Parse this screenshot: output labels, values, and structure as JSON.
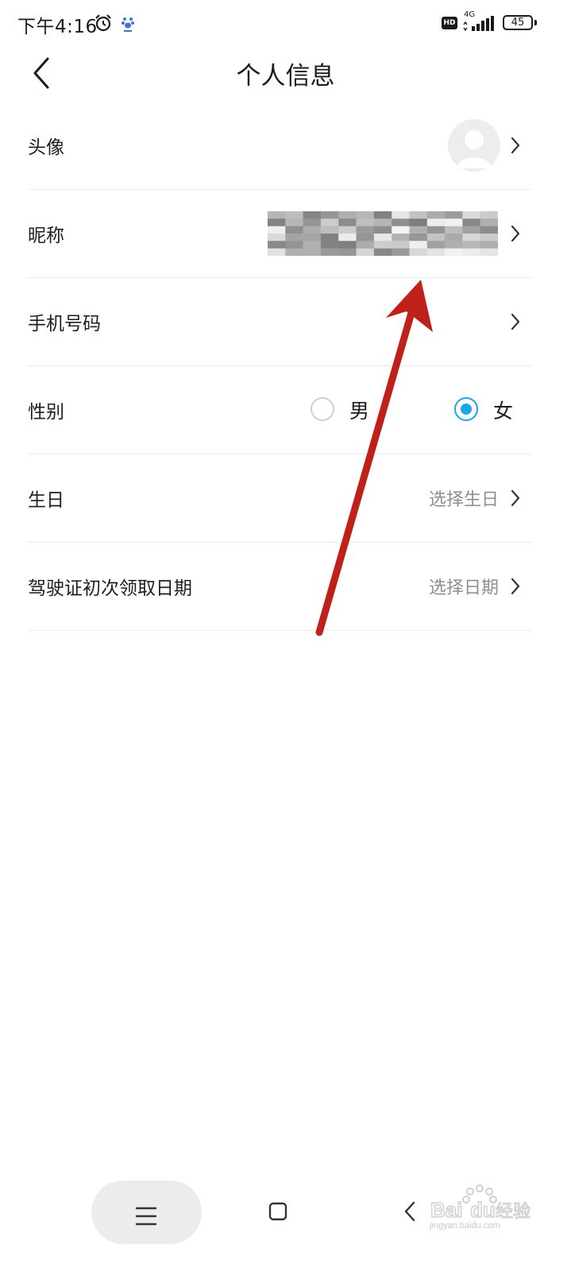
{
  "status_bar": {
    "time": "下午4:16",
    "hd_badge": "HD",
    "network": "4G",
    "battery": "45"
  },
  "header": {
    "title": "个人信息"
  },
  "rows": {
    "avatar": {
      "label": "头像"
    },
    "nickname": {
      "label": "昵称"
    },
    "phone": {
      "label": "手机号码"
    },
    "gender": {
      "label": "性别",
      "options": [
        "男",
        "女"
      ],
      "selected": "女"
    },
    "birthday": {
      "label": "生日",
      "value": "选择生日"
    },
    "license_date": {
      "label": "驾驶证初次领取日期",
      "value": "选择日期"
    }
  },
  "watermark": {
    "text": "jingyan.baidu.com"
  },
  "colors": {
    "accent": "#1aa7e8",
    "annotation_arrow": "#c0201a",
    "secondary_text": "#8e8e93"
  },
  "icons": {
    "back": "chevron-left-icon",
    "row_chevron": "chevron-right-icon",
    "alarm": "alarm-clock-icon",
    "nav_menu": "hamburger-icon",
    "nav_home": "square-icon",
    "nav_back": "triangle-back-icon"
  }
}
